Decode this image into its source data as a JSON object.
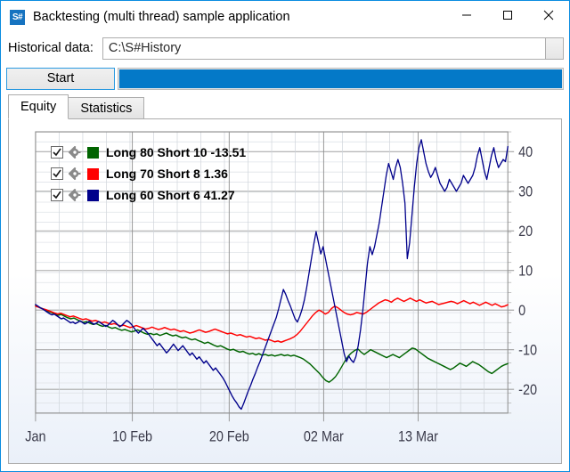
{
  "window": {
    "title": "Backtesting (multi thread) sample application",
    "app_icon_text": "S#",
    "minimize_label": "—",
    "maximize_label": "□",
    "close_label": "✕",
    "accent_color": "#0a8ce0"
  },
  "historical": {
    "label": "Historical data:",
    "value": "C:\\S#History",
    "placeholder": "",
    "browse_label": ""
  },
  "controls": {
    "start_label": "Start",
    "progress_percent": 100,
    "progress_color": "#0479c8"
  },
  "tabs": [
    {
      "label": "Equity",
      "active": true
    },
    {
      "label": "Statistics",
      "active": false
    }
  ],
  "legend": [
    {
      "label": "Long 80 Short 10  -13.51",
      "color": "#006400",
      "checked": true,
      "checkbox_icon": "check-icon",
      "settings_icon": "gear-icon"
    },
    {
      "label": "Long 70 Short 8  1.36",
      "color": "#ff0000",
      "checked": true,
      "checkbox_icon": "check-icon",
      "settings_icon": "gear-icon"
    },
    {
      "label": "Long 60 Short 6  41.27",
      "color": "#00008b",
      "checked": true,
      "checkbox_icon": "check-icon",
      "settings_icon": "gear-icon"
    }
  ],
  "chart_data": {
    "type": "line",
    "title": "",
    "xlabel": "",
    "ylabel": "",
    "grid": true,
    "legend_position": "top-left",
    "ylim": [
      -26,
      45
    ],
    "yticks": [
      40,
      30,
      20,
      10,
      0,
      -10,
      -20
    ],
    "ytick_labels": [
      "40",
      "30",
      "20",
      "10",
      "0",
      "-10",
      "-20"
    ],
    "xtick_labels": [
      "Jan",
      "10 Feb",
      "20 Feb",
      "02 Mar",
      "13 Mar"
    ],
    "xtick_positions": [
      0,
      0.205,
      0.41,
      0.61,
      0.81
    ],
    "x": [
      0,
      0.0067,
      0.0134,
      0.0201,
      0.0268,
      0.0336,
      0.0403,
      0.047,
      0.0537,
      0.0604,
      0.0671,
      0.0738,
      0.0805,
      0.0872,
      0.094,
      0.1007,
      0.1074,
      0.1141,
      0.1208,
      0.1275,
      0.1342,
      0.1409,
      0.1477,
      0.1544,
      0.1611,
      0.1678,
      0.1745,
      0.1812,
      0.1879,
      0.1946,
      0.2013,
      0.2081,
      0.2148,
      0.2215,
      0.2282,
      0.2349,
      0.2416,
      0.2483,
      0.255,
      0.2617,
      0.2685,
      0.2752,
      0.2819,
      0.2886,
      0.2953,
      0.302,
      0.3087,
      0.3154,
      0.3221,
      0.3289,
      0.3356,
      0.3423,
      0.349,
      0.3557,
      0.3624,
      0.3691,
      0.3758,
      0.3826,
      0.3893,
      0.396,
      0.4027,
      0.4094,
      0.4161,
      0.4228,
      0.4295,
      0.4362,
      0.443,
      0.4497,
      0.4564,
      0.4631,
      0.4698,
      0.4765,
      0.4832,
      0.4899,
      0.4966,
      0.5034,
      0.5101,
      0.5168,
      0.5235,
      0.5302,
      0.5369,
      0.5436,
      0.5503,
      0.557,
      0.5638,
      0.5705,
      0.5772,
      0.5839,
      0.5906,
      0.5973,
      0.604,
      0.6107,
      0.6174,
      0.6242,
      0.6309,
      0.6376,
      0.6443,
      0.651,
      0.6577,
      0.6644,
      0.6711,
      0.6779,
      0.6846,
      0.6913,
      0.698,
      0.7047,
      0.7114,
      0.7181,
      0.7248,
      0.7315,
      0.7383,
      0.745,
      0.7517,
      0.7584,
      0.7651,
      0.7718,
      0.7785,
      0.7852,
      0.7919,
      0.7987,
      0.8054,
      0.8121,
      0.8188,
      0.8255,
      0.8322,
      0.8389,
      0.8456,
      0.8523,
      0.8591,
      0.8658,
      0.8725,
      0.8792,
      0.8859,
      0.8926,
      0.8993,
      0.906,
      0.9128,
      0.9195,
      0.9262,
      0.9329,
      0.9396,
      0.9463,
      0.953,
      0.9597,
      0.9664,
      0.9732,
      0.9799,
      0.9866,
      0.9933,
      1.0
    ],
    "series": [
      {
        "name": "Long 80 Short 10",
        "color": "#006400",
        "final_value": -13.51,
        "values": [
          1.2,
          0.8,
          0.4,
          0.1,
          -0.3,
          -0.6,
          -1.0,
          -1.3,
          -1.1,
          -1.5,
          -1.9,
          -2.2,
          -2.0,
          -2.4,
          -2.8,
          -3.1,
          -2.9,
          -3.3,
          -3.6,
          -3.4,
          -3.8,
          -4.1,
          -3.9,
          -4.3,
          -4.6,
          -4.4,
          -4.8,
          -5.1,
          -4.9,
          -5.2,
          -5.5,
          -5.3,
          -5.0,
          -5.4,
          -5.8,
          -6.1,
          -5.9,
          -6.2,
          -6.0,
          -6.4,
          -6.1,
          -5.8,
          -6.2,
          -6.5,
          -6.3,
          -6.7,
          -7.0,
          -6.8,
          -7.2,
          -7.5,
          -7.3,
          -7.7,
          -8.0,
          -8.4,
          -8.1,
          -8.5,
          -8.9,
          -9.2,
          -9.0,
          -9.4,
          -9.8,
          -10.1,
          -9.9,
          -10.3,
          -10.6,
          -10.4,
          -10.8,
          -11.1,
          -10.9,
          -11.3,
          -11.0,
          -11.4,
          -11.2,
          -11.5,
          -11.3,
          -11.6,
          -11.4,
          -11.2,
          -11.5,
          -11.3,
          -11.6,
          -11.4,
          -11.7,
          -12.0,
          -12.4,
          -13.0,
          -13.6,
          -14.4,
          -15.2,
          -16.0,
          -17.0,
          -17.8,
          -18.2,
          -17.6,
          -16.8,
          -15.6,
          -14.2,
          -12.8,
          -11.6,
          -10.8,
          -10.2,
          -9.8,
          -10.6,
          -11.2,
          -10.6,
          -10.0,
          -10.4,
          -10.8,
          -11.2,
          -11.6,
          -12.0,
          -11.6,
          -11.2,
          -11.6,
          -12.0,
          -11.4,
          -10.8,
          -10.2,
          -9.6,
          -9.8,
          -10.4,
          -11.0,
          -11.6,
          -12.2,
          -12.6,
          -13.0,
          -13.4,
          -13.8,
          -14.2,
          -14.6,
          -15.0,
          -14.6,
          -14.0,
          -13.4,
          -13.8,
          -14.2,
          -13.6,
          -13.0,
          -13.4,
          -13.8,
          -14.4,
          -15.0,
          -15.6,
          -16.0,
          -15.4,
          -14.8,
          -14.2,
          -13.8,
          -13.51
        ]
      },
      {
        "name": "Long 70 Short 8",
        "color": "#ff0000",
        "final_value": 1.36,
        "values": [
          1.0,
          0.7,
          0.4,
          0.2,
          -0.1,
          -0.4,
          -0.7,
          -1.0,
          -0.8,
          -1.1,
          -1.4,
          -1.7,
          -1.5,
          -1.8,
          -2.1,
          -2.4,
          -2.2,
          -2.5,
          -2.8,
          -2.6,
          -2.9,
          -3.2,
          -3.0,
          -3.3,
          -3.6,
          -3.4,
          -3.7,
          -4.0,
          -3.8,
          -4.1,
          -4.4,
          -4.2,
          -3.9,
          -4.2,
          -4.5,
          -4.8,
          -4.6,
          -4.3,
          -4.6,
          -4.9,
          -4.7,
          -4.4,
          -4.7,
          -5.0,
          -4.8,
          -5.1,
          -5.4,
          -5.2,
          -5.5,
          -5.8,
          -5.6,
          -5.3,
          -5.0,
          -5.3,
          -5.6,
          -5.4,
          -5.1,
          -4.8,
          -5.1,
          -5.4,
          -5.7,
          -6.0,
          -5.8,
          -6.1,
          -6.4,
          -6.2,
          -6.5,
          -6.8,
          -6.6,
          -6.9,
          -7.2,
          -7.0,
          -7.3,
          -7.6,
          -7.4,
          -7.7,
          -8.0,
          -7.8,
          -8.1,
          -7.8,
          -7.5,
          -7.2,
          -6.8,
          -6.2,
          -5.4,
          -4.4,
          -3.4,
          -2.4,
          -1.4,
          -0.6,
          0.0,
          -0.4,
          -1.0,
          -0.6,
          0.4,
          1.0,
          0.6,
          0.0,
          -0.6,
          -1.0,
          -1.2,
          -1.0,
          -0.6,
          -0.8,
          -1.0,
          -0.6,
          0.0,
          0.6,
          1.2,
          1.8,
          2.2,
          2.6,
          2.4,
          2.0,
          2.6,
          3.0,
          2.6,
          2.2,
          2.6,
          3.0,
          2.6,
          2.2,
          2.6,
          2.2,
          1.8,
          2.0,
          2.2,
          1.8,
          1.4,
          1.6,
          1.8,
          2.0,
          2.2,
          2.0,
          1.6,
          2.0,
          2.4,
          2.0,
          1.6,
          2.0,
          1.6,
          1.2,
          1.6,
          2.0,
          1.6,
          1.2,
          1.6,
          1.2,
          0.8,
          1.0,
          1.36
        ]
      },
      {
        "name": "Long 60 Short 6",
        "color": "#00008b",
        "final_value": 41.27,
        "values": [
          1.4,
          1.0,
          0.6,
          0.3,
          -0.1,
          -0.5,
          -0.9,
          -1.2,
          -1.0,
          -1.4,
          -1.8,
          -2.2,
          -2.0,
          -2.4,
          -2.8,
          -3.2,
          -3.0,
          -3.4,
          -3.1,
          -2.7,
          -3.1,
          -3.5,
          -3.2,
          -2.8,
          -3.2,
          -3.6,
          -3.3,
          -2.9,
          -3.3,
          -3.7,
          -4.1,
          -3.8,
          -3.2,
          -2.6,
          -3.0,
          -3.6,
          -4.2,
          -3.8,
          -3.2,
          -2.6,
          -3.0,
          -3.6,
          -4.4,
          -5.2,
          -5.8,
          -5.2,
          -4.6,
          -5.2,
          -5.8,
          -6.6,
          -7.4,
          -8.2,
          -9.0,
          -8.4,
          -9.2,
          -10.0,
          -10.8,
          -10.2,
          -9.4,
          -8.6,
          -9.4,
          -10.2,
          -9.6,
          -9.0,
          -9.8,
          -10.6,
          -11.4,
          -10.8,
          -11.6,
          -12.4,
          -11.8,
          -12.6,
          -13.4,
          -12.8,
          -13.6,
          -14.4,
          -15.2,
          -14.6,
          -15.4,
          -16.2,
          -17.0,
          -18.0,
          -19.2,
          -20.4,
          -21.6,
          -22.6,
          -23.4,
          -24.4,
          -25.0,
          -23.6,
          -22.0,
          -20.4,
          -19.0,
          -17.4,
          -16.0,
          -14.4,
          -13.0,
          -11.4,
          -9.8,
          -8.2,
          -6.6,
          -5.0,
          -3.4,
          -1.8,
          0.4,
          2.8,
          5.2,
          4.0,
          2.4,
          1.0,
          -0.6,
          -2.2,
          -3.0,
          -1.6,
          0.2,
          2.6,
          5.8,
          9.4,
          13.0,
          16.6,
          19.8,
          17.0,
          14.2,
          16.0,
          13.0,
          10.0,
          7.0,
          4.0,
          1.0,
          -2.0,
          -5.0,
          -8.0,
          -11.0,
          -13.0,
          -11.6,
          -12.6,
          -13.2,
          -11.8,
          -9.0,
          -5.0,
          0.0,
          6.0,
          12.0,
          16.0,
          14.0,
          16.0,
          19.0,
          22.0,
          26.0,
          30.0,
          34.0,
          37.0,
          35.0,
          33.0,
          36.0,
          38.0,
          36.0,
          32.0,
          27.0,
          13.0,
          17.0,
          24.0,
          31.0,
          37.0,
          41.0,
          43.0,
          40.0,
          37.0,
          35.0,
          33.5,
          34.5,
          36.0,
          34.0,
          32.0,
          31.0,
          30.0,
          31.0,
          33.0,
          32.0,
          31.0,
          30.0,
          31.0,
          32.0,
          34.0,
          33.0,
          32.0,
          33.0,
          34.0,
          36.0,
          39.0,
          41.0,
          38.0,
          35.0,
          33.0,
          36.0,
          39.0,
          41.0,
          38.0,
          36.0,
          37.0,
          38.0,
          37.5,
          41.27
        ]
      }
    ]
  }
}
